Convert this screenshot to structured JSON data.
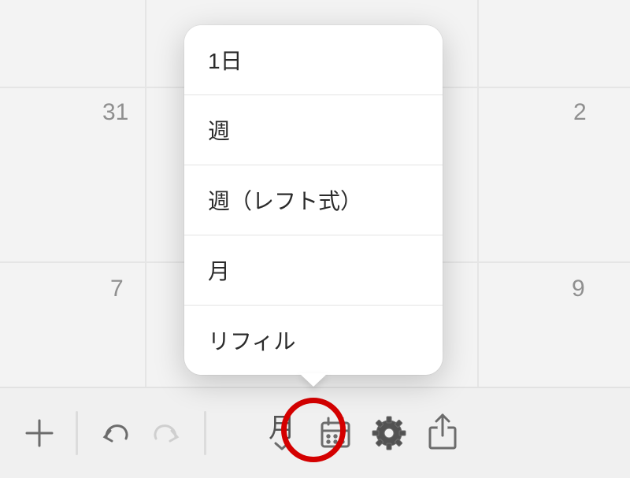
{
  "calendar": {
    "cells": [
      {
        "label": "31"
      },
      {
        "label": "2"
      },
      {
        "label": "7"
      },
      {
        "label": "9"
      }
    ]
  },
  "toolbar": {
    "add_label": "+",
    "undo_label": "undo",
    "redo_label": "redo",
    "view_label": "月",
    "calendar_label": "calendar",
    "settings_label": "settings",
    "share_label": "share"
  },
  "popover": {
    "items": [
      {
        "label": "1日"
      },
      {
        "label": "週"
      },
      {
        "label": "週（レフト式）"
      },
      {
        "label": "月"
      },
      {
        "label": "リフィル"
      }
    ]
  }
}
